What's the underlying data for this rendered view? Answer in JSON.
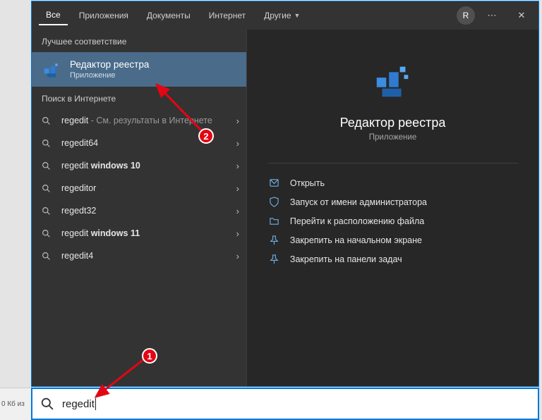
{
  "tabs": {
    "all": "Все",
    "apps": "Приложения",
    "docs": "Документы",
    "web": "Интернет",
    "more": "Другие"
  },
  "avatar_letter": "R",
  "left": {
    "best_header": "Лучшее соответствие",
    "best_title": "Редактор реестра",
    "best_sub": "Приложение",
    "web_header": "Поиск в Интернете",
    "results": [
      {
        "term": "regedit",
        "suffix": " - См. результаты в Интернете"
      },
      {
        "term": "regedit64",
        "suffix": ""
      },
      {
        "prefix": "regedit ",
        "bold": "windows 10"
      },
      {
        "term": "regeditor",
        "suffix": ""
      },
      {
        "term": "regedt32",
        "suffix": ""
      },
      {
        "prefix": "regedit ",
        "bold": "windows 11"
      },
      {
        "term": "regedit4",
        "suffix": ""
      }
    ]
  },
  "detail": {
    "title": "Редактор реестра",
    "sub": "Приложение",
    "actions": {
      "open": "Открыть",
      "admin": "Запуск от имени администратора",
      "location": "Перейти к расположению файла",
      "pin_start": "Закрепить на начальном экране",
      "pin_taskbar": "Закрепить на панели задач"
    }
  },
  "search": {
    "query": "regedit"
  },
  "status_sliver": "0 Кб из",
  "annotations": {
    "m1": "1",
    "m2": "2"
  }
}
